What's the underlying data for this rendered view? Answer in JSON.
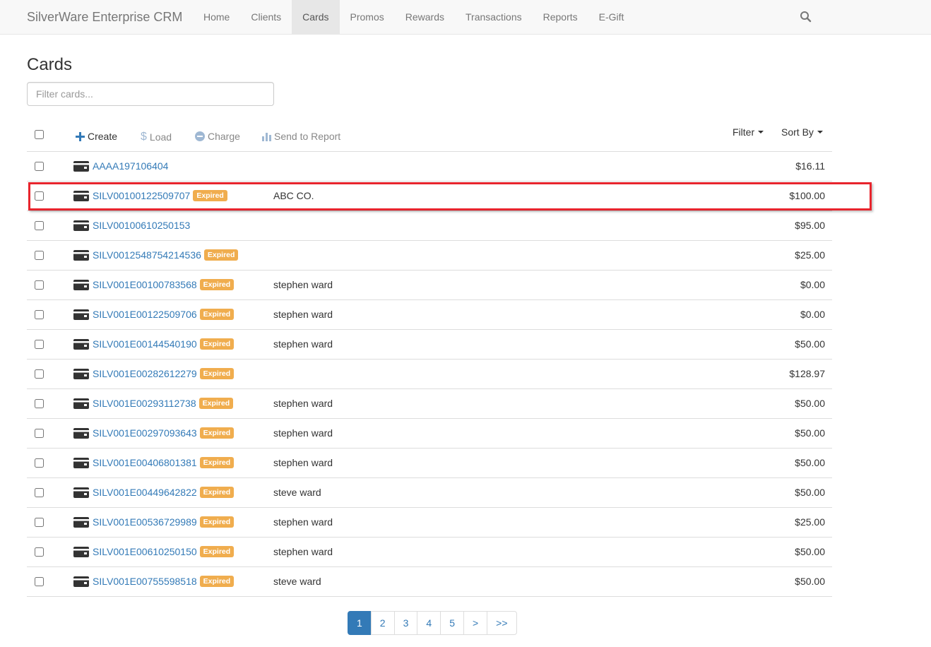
{
  "navbar": {
    "brand": "SilverWare Enterprise CRM",
    "items": [
      {
        "label": "Home",
        "name": "home"
      },
      {
        "label": "Clients",
        "name": "clients"
      },
      {
        "label": "Cards",
        "name": "cards",
        "active": true
      },
      {
        "label": "Promos",
        "name": "promos"
      },
      {
        "label": "Rewards",
        "name": "rewards"
      },
      {
        "label": "Transactions",
        "name": "transactions"
      },
      {
        "label": "Reports",
        "name": "reports"
      },
      {
        "label": "E-Gift",
        "name": "e-gift"
      }
    ],
    "search_icon": "search-icon"
  },
  "page": {
    "title": "Cards",
    "filter_placeholder": "Filter cards..."
  },
  "toolbar": {
    "create": "Create",
    "load": "Load",
    "charge": "Charge",
    "send_to_report": "Send to Report",
    "filter": "Filter",
    "sort_by": "Sort By"
  },
  "colors": {
    "link": "#337ab7",
    "expired_badge": "#f0ad4e",
    "highlight": "#e8242d",
    "active_page": "#337ab7"
  },
  "cards": [
    {
      "number": "AAAA197106404",
      "expired": false,
      "owner": "",
      "amount": "$16.11"
    },
    {
      "number": "SILV00100122509707",
      "expired": true,
      "owner": "ABC CO.",
      "amount": "$100.00",
      "highlighted": true
    },
    {
      "number": "SILV00100610250153",
      "expired": false,
      "owner": "",
      "amount": "$95.00"
    },
    {
      "number": "SILV0012548754214536",
      "expired": true,
      "owner": "",
      "amount": "$25.00"
    },
    {
      "number": "SILV001E00100783568",
      "expired": true,
      "owner": "stephen ward",
      "amount": "$0.00"
    },
    {
      "number": "SILV001E00122509706",
      "expired": true,
      "owner": "stephen ward",
      "amount": "$0.00"
    },
    {
      "number": "SILV001E00144540190",
      "expired": true,
      "owner": "stephen ward",
      "amount": "$50.00"
    },
    {
      "number": "SILV001E00282612279",
      "expired": true,
      "owner": "",
      "amount": "$128.97"
    },
    {
      "number": "SILV001E00293112738",
      "expired": true,
      "owner": "stephen ward",
      "amount": "$50.00"
    },
    {
      "number": "SILV001E00297093643",
      "expired": true,
      "owner": "stephen ward",
      "amount": "$50.00"
    },
    {
      "number": "SILV001E00406801381",
      "expired": true,
      "owner": "stephen ward",
      "amount": "$50.00"
    },
    {
      "number": "SILV001E00449642822",
      "expired": true,
      "owner": "steve ward",
      "amount": "$50.00"
    },
    {
      "number": "SILV001E00536729989",
      "expired": true,
      "owner": "stephen ward",
      "amount": "$25.00"
    },
    {
      "number": "SILV001E00610250150",
      "expired": true,
      "owner": "stephen ward",
      "amount": "$50.00"
    },
    {
      "number": "SILV001E00755598518",
      "expired": true,
      "owner": "steve ward",
      "amount": "$50.00"
    }
  ],
  "expired_label": "Expired",
  "pagination": {
    "pages": [
      "1",
      "2",
      "3",
      "4",
      "5",
      ">",
      ">>"
    ],
    "active": "1"
  }
}
